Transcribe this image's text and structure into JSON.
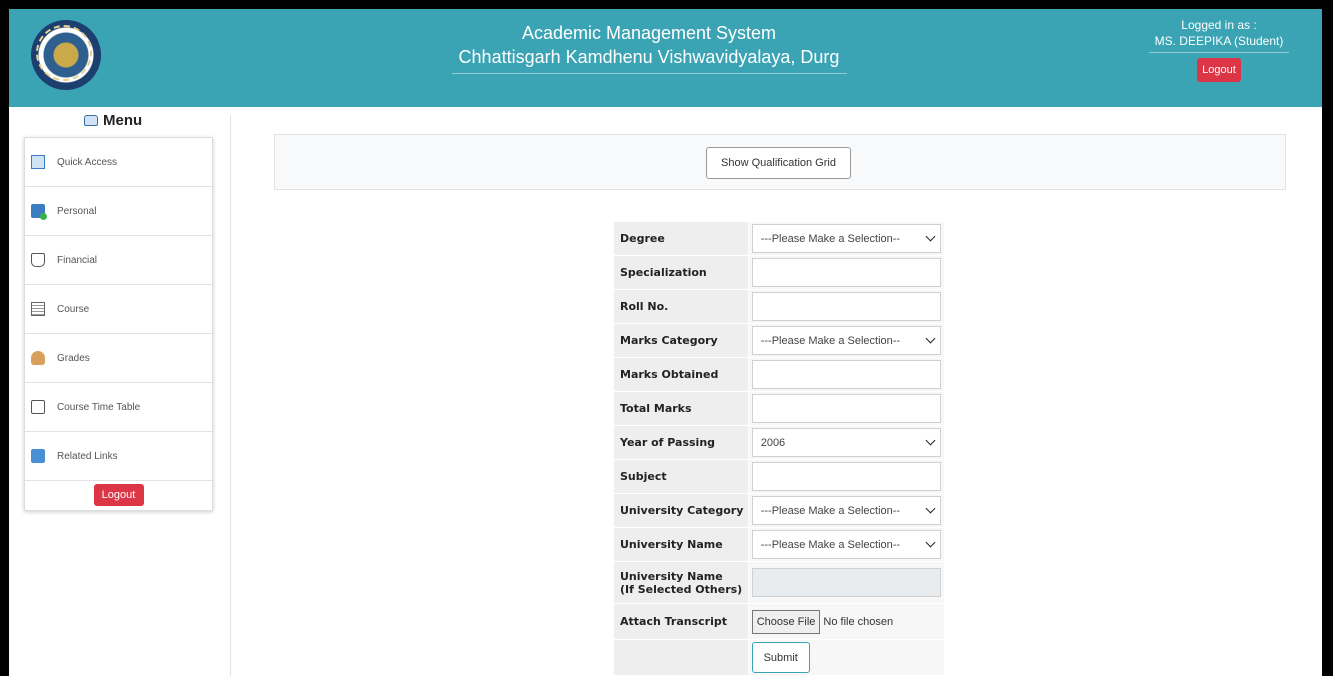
{
  "header": {
    "title_line1": "Academic Management System",
    "title_line2": "Chhattisgarh Kamdhenu Vishwavidyalaya, Durg",
    "logged_in_label": "Logged in as :",
    "user": "MS. DEEPIKA (Student)",
    "logout_label": "Logout",
    "bg_color": "#3aa3b4"
  },
  "sidebar": {
    "menu_label": "Menu",
    "items": [
      {
        "label": "Quick Access",
        "icon": "quick-access-icon"
      },
      {
        "label": "Personal",
        "icon": "personal-icon"
      },
      {
        "label": "Financial",
        "icon": "financial-icon"
      },
      {
        "label": "Course",
        "icon": "course-icon"
      },
      {
        "label": "Grades",
        "icon": "grades-icon"
      },
      {
        "label": "Course Time Table",
        "icon": "timetable-icon"
      },
      {
        "label": "Related Links",
        "icon": "related-links-icon"
      }
    ],
    "logout_label": "Logout"
  },
  "grid_bar": {
    "button_label": "Show Qualification Grid"
  },
  "form": {
    "degree": {
      "label": "Degree",
      "value": "---Please Make a Selection--"
    },
    "specialization": {
      "label": "Specialization",
      "value": ""
    },
    "roll_no": {
      "label": "Roll No.",
      "value": ""
    },
    "marks_category": {
      "label": "Marks Category",
      "value": "---Please Make a Selection--"
    },
    "marks_obtained": {
      "label": "Marks Obtained",
      "value": ""
    },
    "total_marks": {
      "label": "Total Marks",
      "value": ""
    },
    "year_of_passing": {
      "label": "Year of Passing",
      "value": "2006"
    },
    "subject": {
      "label": "Subject",
      "value": ""
    },
    "university_category": {
      "label": "University Category",
      "value": "---Please Make a Selection--"
    },
    "university_name": {
      "label": "University Name",
      "value": "---Please Make a Selection--"
    },
    "university_other": {
      "label_line1": "University Name",
      "label_line2": "(If Selected Others)",
      "value": ""
    },
    "attach_transcript": {
      "label": "Attach Transcript",
      "button": "Choose File",
      "status": "No file chosen"
    },
    "submit_label": "Submit"
  }
}
